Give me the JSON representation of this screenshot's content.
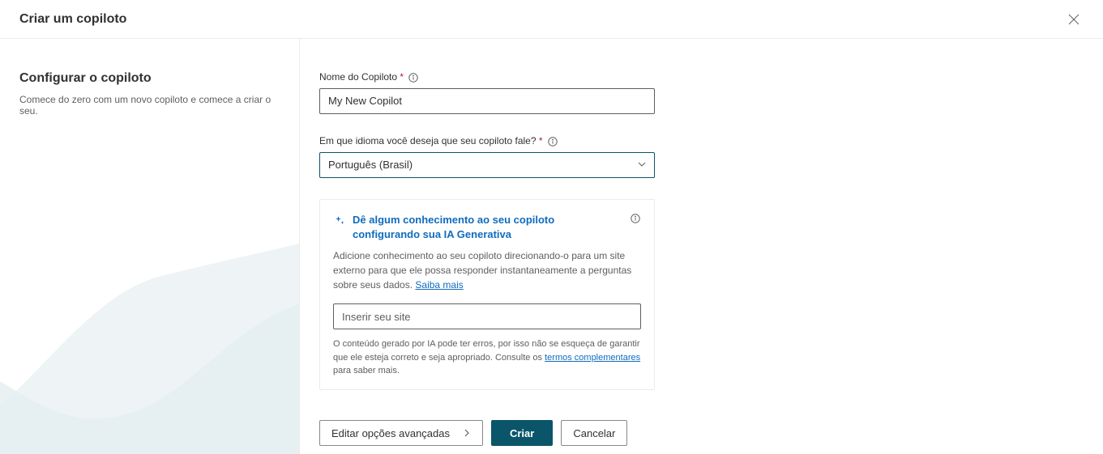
{
  "header": {
    "title": "Criar um copiloto"
  },
  "sidebar": {
    "title": "Configurar o copiloto",
    "subtitle": "Comece do zero com um novo copiloto e comece a criar o seu."
  },
  "form": {
    "name_label": "Nome do Copiloto",
    "name_value": "My New Copilot",
    "language_label": "Em que idioma você deseja que seu copiloto fale?",
    "language_value": "Português (Brasil)"
  },
  "knowledge": {
    "title": "Dê algum conhecimento ao seu copiloto configurando sua IA Generativa",
    "description_prefix": "Adicione conhecimento ao seu copiloto direcionando-o para um site externo para que ele possa responder instantaneamente a perguntas sobre seus dados. ",
    "learn_more": "Saiba mais",
    "site_placeholder": "Inserir seu site",
    "disclaimer_prefix": "O conteúdo gerado por IA pode ter erros, por isso não se esqueça de garantir que ele esteja correto e seja apropriado. Consulte os ",
    "disclaimer_link": "termos complementares",
    "disclaimer_suffix": " para saber mais."
  },
  "footer": {
    "edit_advanced": "Editar opções avançadas",
    "create": "Criar",
    "cancel": "Cancelar"
  }
}
